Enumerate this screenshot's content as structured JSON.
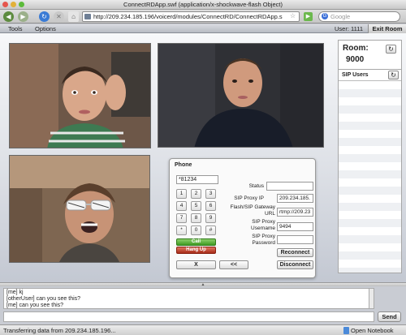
{
  "window": {
    "title": "ConnectRDApp.swf (application/x-shockwave-flash Object)"
  },
  "browser": {
    "url": "http://209.234.185.196/voicerd/modules/ConnectRD/ConnectRDApp.s",
    "search_placeholder": "Google",
    "icons": [
      "back-icon",
      "forward-icon",
      "reload-icon",
      "stop-icon",
      "home-icon",
      "bookmark-star-icon",
      "go-icon",
      "google-search-icon"
    ]
  },
  "app_menu": {
    "tools_label": "Tools",
    "options_label": "Options",
    "user_label": "User: 1111",
    "exit_label": "Exit Room"
  },
  "room": {
    "title": "Room:",
    "number": "9000"
  },
  "sip_users": {
    "title": "SIP Users",
    "items": []
  },
  "phone": {
    "title": "Phone",
    "dial_value": "*81234",
    "keypad": [
      "1",
      "2",
      "3",
      "4",
      "5",
      "6",
      "7",
      "8",
      "9",
      "*",
      "0",
      "#"
    ],
    "call_label": "Call",
    "hangup_label": "Hang Up",
    "clear_label": "X",
    "back_label": "<<",
    "status_label": "Status",
    "status_value": "",
    "proxy_ip_label": "SIP Proxy IP",
    "proxy_ip_value": "209.234.185.",
    "gateway_label": "Flash/SIP Gateway URL",
    "gateway_value": "rtmp://209.23",
    "username_label": "SIP Proxy Username",
    "username_value": "9494",
    "password_label": "SIP Proxy Password",
    "password_value": "",
    "reconnect_label": "Reconnect",
    "disconnect_label": "Disconnect"
  },
  "chat": {
    "lines": [
      "[me] kj",
      "[otherUser] can you see this?",
      "[me] can you see this?"
    ],
    "input_value": "",
    "send_label": "Send"
  },
  "status_bar": {
    "text": "Transferring data from 209.234.185.196...",
    "notebook_label": "Open Notebook"
  },
  "colors": {
    "call_green": "#3f9a22",
    "hangup_red": "#a82c18",
    "stage_bg": "#dde0e6"
  }
}
